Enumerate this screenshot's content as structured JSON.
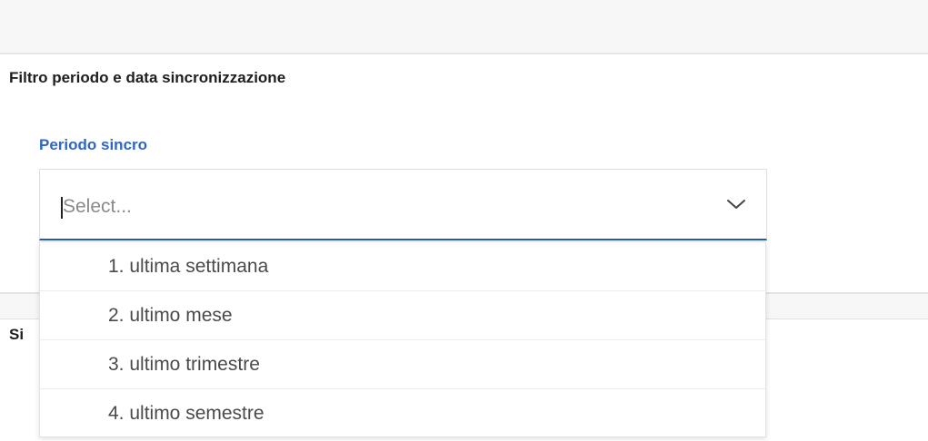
{
  "section": {
    "title": "Filtro periodo e data sincronizzazione"
  },
  "field": {
    "label": "Periodo sincro",
    "placeholder": "Select...",
    "icon": "chevron-down-icon"
  },
  "lower_section": {
    "title_partial": "Si"
  },
  "dropdown": {
    "options": [
      "1. ultima settimana",
      "2. ultimo mese",
      "3. ultimo trimestre",
      "4. ultimo semestre"
    ]
  },
  "colors": {
    "label_blue": "#3066c2",
    "focus_border": "#1f5fb8",
    "placeholder": "#8a8a8a"
  }
}
